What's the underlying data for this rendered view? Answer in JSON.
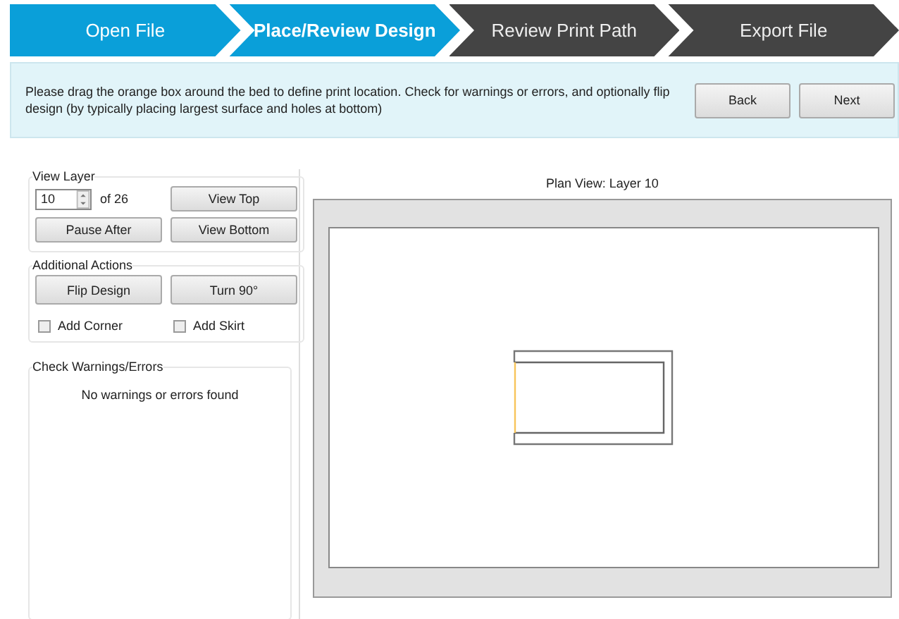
{
  "steps": [
    {
      "label": "Open File",
      "selected": false,
      "completed": true
    },
    {
      "label": "Place/Review Design",
      "selected": true,
      "completed": false
    },
    {
      "label": "Review Print Path",
      "selected": false,
      "completed": false
    },
    {
      "label": "Export File",
      "selected": false,
      "completed": false
    }
  ],
  "instructions": "Please drag the orange box around the bed to define print location. Check for warnings or errors, and optionally flip design (by typically placing largest surface and holes at bottom)",
  "nav_buttons": [
    "Back",
    "Next"
  ],
  "view_layer": {
    "title": "View Layer",
    "layer": "10",
    "of": "of 26",
    "buttons": [
      "View Top",
      "Pause After",
      "View Bottom"
    ]
  },
  "additional_actions": {
    "title": "Additional Actions",
    "buttons": [
      "Flip Design",
      "Turn 90°"
    ],
    "options": [
      {
        "label": "Add Corner",
        "checked": false
      },
      {
        "label": "Add Skirt",
        "checked": false
      }
    ]
  },
  "warnings": {
    "title": "Check Warnings/Errors",
    "message": "No warnings or errors found"
  },
  "plan_view": {
    "title": "Plan View: Layer 10"
  }
}
